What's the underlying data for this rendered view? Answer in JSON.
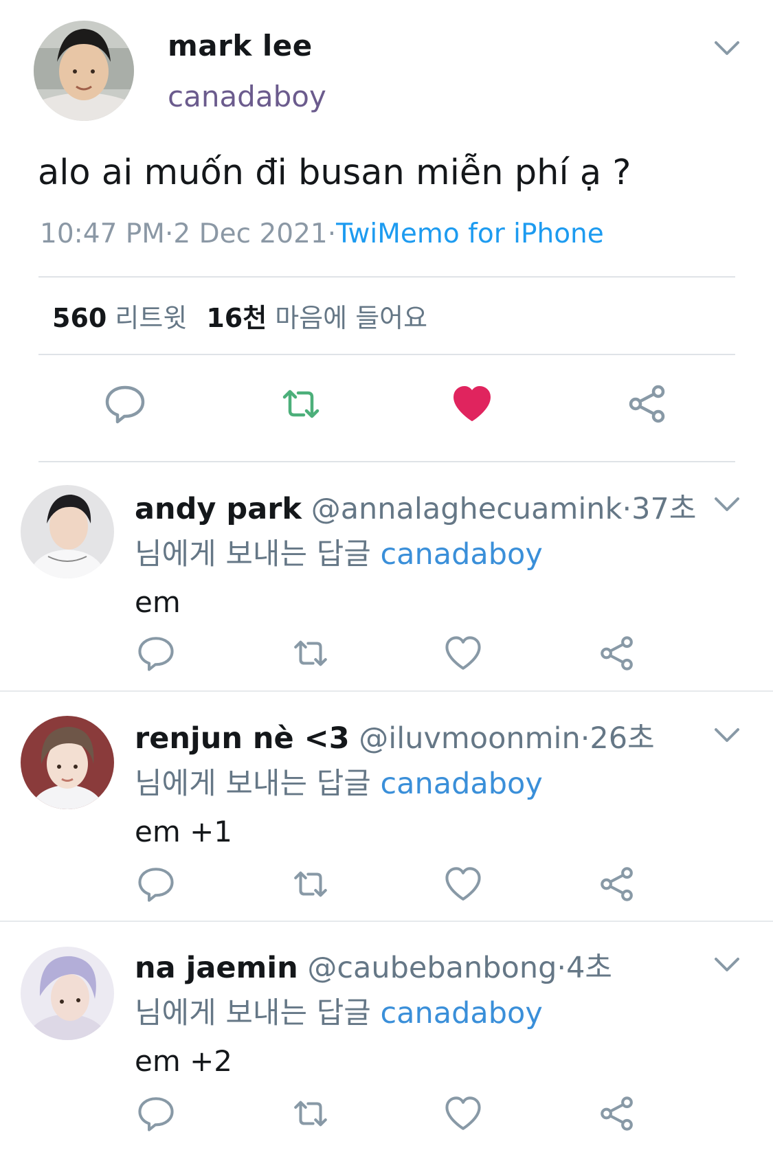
{
  "colors": {
    "accent": "#1d9bf0",
    "retweet": "#4caf7a",
    "like": "#e0245e",
    "icon_gray": "#8899a6"
  },
  "tweet": {
    "author_name": "mark lee",
    "author_handle": "canadaboy",
    "text": "alo ai muốn đi busan miễn phí ạ ?",
    "time": "10:47 PM",
    "dot1": "·",
    "date": "2 Dec 2021",
    "dot2": "·",
    "source": "TwiMemo for iPhone",
    "retweet_count": "560",
    "retweet_label": "리트윗",
    "like_count": "16천",
    "like_label": "마음에 들어요",
    "icons": [
      "reply-icon",
      "retweet-icon",
      "like-icon",
      "share-icon"
    ]
  },
  "replies": [
    {
      "name": "andy park",
      "handle": "@annalaghecuamink",
      "time": "·37초",
      "reply_prefix": "님에게 보내는 답글",
      "reply_to": "canadaboy",
      "text": "em"
    },
    {
      "name": "renjun nè <3",
      "handle": "@iluvmoonmin",
      "time": "·26초",
      "reply_prefix": "님에게 보내는 답글",
      "reply_to": "canadaboy",
      "text": "em +1"
    },
    {
      "name": "na jaemin",
      "handle": "@caubebanbong",
      "time": "·4초",
      "reply_prefix": "님에게 보내는 답글",
      "reply_to": "canadaboy",
      "text": "em +2"
    }
  ]
}
